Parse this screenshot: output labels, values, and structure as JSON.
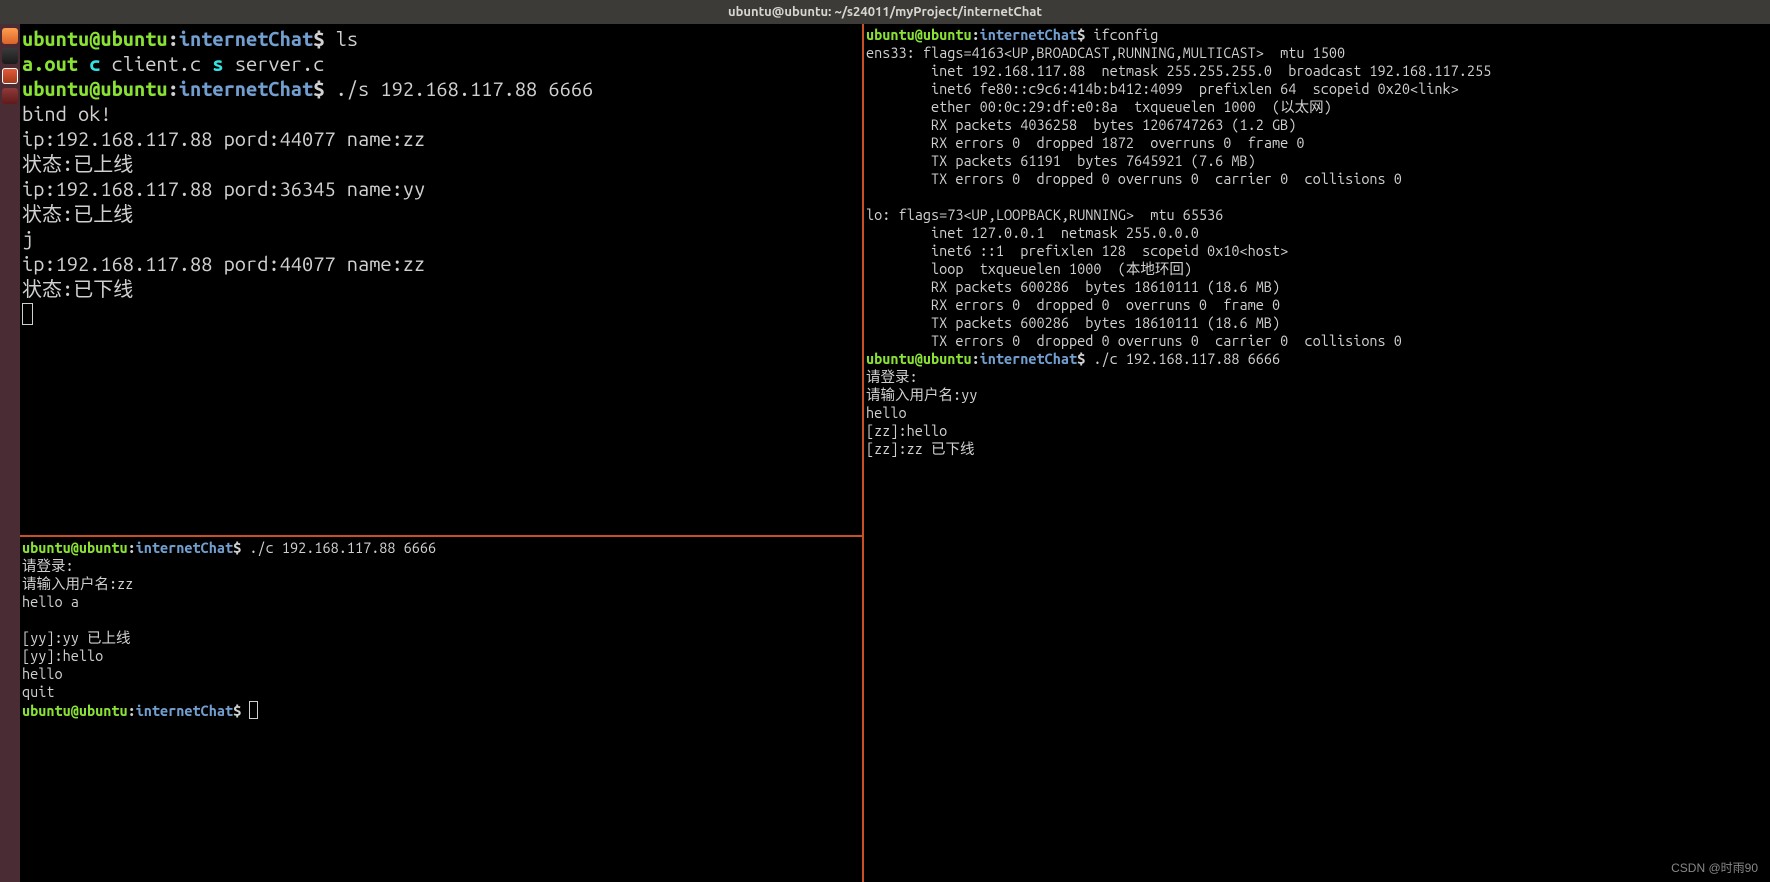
{
  "title": "ubuntu@ubuntu: ~/s24011/myProject/internetChat",
  "prompt": {
    "user": "ubuntu@ubuntu",
    "path": "internetChat",
    "dollar": "$"
  },
  "pane_top": {
    "cmd1": "ls",
    "ls_out": {
      "aout": "a.out",
      "c": "c",
      "clientc": "client.c",
      "s": "s",
      "serverc": "server.c"
    },
    "cmd2": "./s 192.168.117.88 6666",
    "lines": [
      "bind ok!",
      "ip:192.168.117.88 pord:44077 name:zz",
      "状态:已上线",
      "ip:192.168.117.88 pord:36345 name:yy",
      "状态:已上线",
      "j",
      "ip:192.168.117.88 pord:44077 name:zz",
      "状态:已下线"
    ]
  },
  "pane_bottom": {
    "cmd": "./c 192.168.117.88 6666",
    "lines": [
      "请登录:",
      "请输入用户名:zz",
      "hello a",
      "",
      "[yy]:yy 已上线",
      "[yy]:hello",
      "hello",
      "quit"
    ]
  },
  "pane_right": {
    "cmd1": "ifconfig",
    "ifconfig": [
      "ens33: flags=4163<UP,BROADCAST,RUNNING,MULTICAST>  mtu 1500",
      "        inet 192.168.117.88  netmask 255.255.255.0  broadcast 192.168.117.255",
      "        inet6 fe80::c9c6:414b:b412:4099  prefixlen 64  scopeid 0x20<link>",
      "        ether 00:0c:29:df:e0:8a  txqueuelen 1000  (以太网)",
      "        RX packets 4036258  bytes 1206747263 (1.2 GB)",
      "        RX errors 0  dropped 1872  overruns 0  frame 0",
      "        TX packets 61191  bytes 7645921 (7.6 MB)",
      "        TX errors 0  dropped 0 overruns 0  carrier 0  collisions 0",
      "",
      "lo: flags=73<UP,LOOPBACK,RUNNING>  mtu 65536",
      "        inet 127.0.0.1  netmask 255.0.0.0",
      "        inet6 ::1  prefixlen 128  scopeid 0x10<host>",
      "        loop  txqueuelen 1000  (本地环回)",
      "        RX packets 600286  bytes 18610111 (18.6 MB)",
      "        RX errors 0  dropped 0  overruns 0  frame 0",
      "        TX packets 600286  bytes 18610111 (18.6 MB)",
      "        TX errors 0  dropped 0 overruns 0  carrier 0  collisions 0",
      ""
    ],
    "cmd2": "./c 192.168.117.88 6666",
    "lines": [
      "请登录:",
      "请输入用户名:yy",
      "hello",
      "[zz]:hello",
      "[zz]:zz 已下线"
    ]
  },
  "watermark": "CSDN @时雨90"
}
